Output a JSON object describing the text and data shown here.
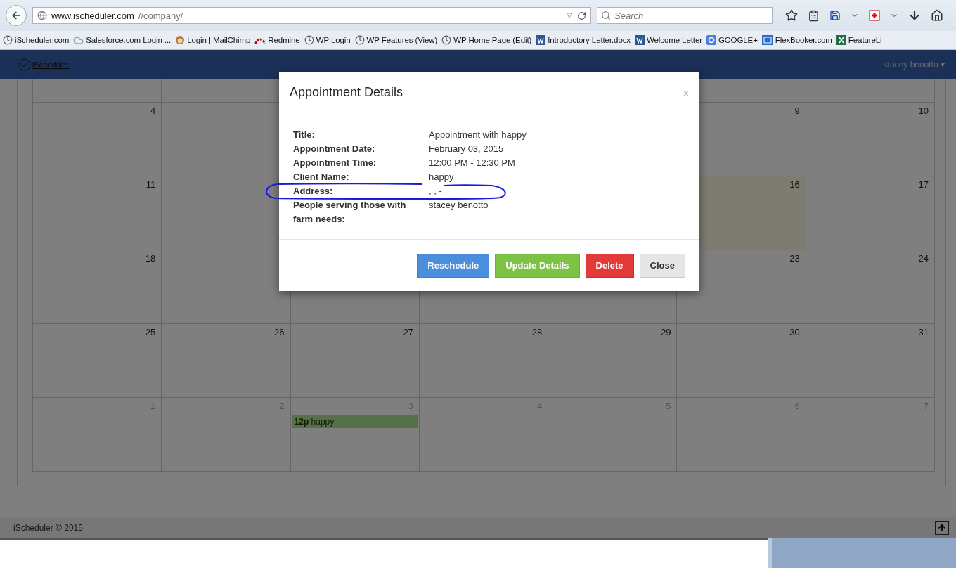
{
  "browser": {
    "url_host": "www.ischeduler.com",
    "url_path": "//company/",
    "search_placeholder": "Search",
    "bookmarks": [
      {
        "kind": "clock",
        "label": "iScheduler.com"
      },
      {
        "kind": "cloud",
        "label": "Salesforce.com Login ..."
      },
      {
        "kind": "monkey",
        "label": "Login | MailChimp"
      },
      {
        "kind": "arc",
        "label": "Redmine"
      },
      {
        "kind": "clock",
        "label": "WP Login"
      },
      {
        "kind": "clock",
        "label": "WP Features (View)"
      },
      {
        "kind": "clock",
        "label": "WP Home Page (Edit)"
      },
      {
        "kind": "word",
        "label": "Introductory Letter.docx"
      },
      {
        "kind": "word",
        "label": "Welcome Letter"
      },
      {
        "kind": "google",
        "label": "GOOGLE+"
      },
      {
        "kind": "fb",
        "label": "FlexBooker.com"
      },
      {
        "kind": "excel",
        "label": "FeatureLi"
      }
    ]
  },
  "app": {
    "logo": "iScheduler",
    "user": "stacey benotto ▾"
  },
  "calendar": {
    "weeks": [
      {
        "start": [
          {
            "day": "4",
            "highlighted": false,
            "other_month": false
          }
        ],
        "end": [
          {
            "day": "9",
            "highlighted": false,
            "other_month": false
          },
          {
            "day": "10",
            "highlighted": false,
            "other_month": false
          }
        ]
      },
      {
        "start": [
          {
            "day": "11",
            "highlighted": false,
            "other_month": false
          }
        ],
        "end": [
          {
            "day": "16",
            "highlighted": true,
            "other_month": false
          },
          {
            "day": "17",
            "highlighted": false,
            "other_month": false
          }
        ]
      },
      {
        "start": [
          {
            "day": "18",
            "highlighted": false,
            "other_month": false
          }
        ],
        "end": [
          {
            "day": "23",
            "highlighted": false,
            "other_month": false
          },
          {
            "day": "24",
            "highlighted": false,
            "other_month": false
          }
        ]
      },
      {
        "start": [
          {
            "day": "25",
            "highlighted": false,
            "other_month": false
          },
          {
            "day": "26",
            "highlighted": false,
            "other_month": false
          },
          {
            "day": "27",
            "highlighted": false,
            "other_month": false
          },
          {
            "day": "28",
            "highlighted": false,
            "other_month": false
          },
          {
            "day": "29",
            "highlighted": false,
            "other_month": false
          },
          {
            "day": "30",
            "highlighted": false,
            "other_month": false
          },
          {
            "day": "31",
            "highlighted": false,
            "other_month": false
          }
        ]
      },
      {
        "start": [
          {
            "day": "1",
            "highlighted": false,
            "other_month": true
          },
          {
            "day": "2",
            "highlighted": false,
            "other_month": true
          },
          {
            "day": "3",
            "highlighted": false,
            "other_month": true,
            "events": [
              {
                "text": "**12p** happy"
              }
            ]
          },
          {
            "day": "4",
            "highlighted": false,
            "other_month": true
          },
          {
            "day": "5",
            "highlighted": false,
            "other_month": true
          },
          {
            "day": "6",
            "highlighted": false,
            "other_month": true
          },
          {
            "day": "7",
            "highlighted": false,
            "other_month": true
          }
        ]
      }
    ]
  },
  "modal": {
    "title": "Appointment Details",
    "close": "x",
    "details": [
      {
        "label": "Title:",
        "value": "Appointment with happy"
      },
      {
        "label": "Appointment Date:",
        "value": "February 03, 2015"
      },
      {
        "label": "Appointment Time:",
        "value": "12:00 PM - 12:30 PM"
      },
      {
        "label": "Client Name:",
        "value": "happy"
      },
      {
        "label": "Address:",
        "value": ", , -"
      },
      {
        "label": "People serving those with farm needs:",
        "value": "stacey benotto"
      }
    ],
    "buttons": [
      {
        "kind": "primary",
        "label": "Reschedule"
      },
      {
        "kind": "success",
        "label": "Update Details"
      },
      {
        "kind": "danger",
        "label": "Delete"
      },
      {
        "kind": "default",
        "label": "Close"
      }
    ]
  },
  "footer": {
    "copyright": "iScheduler © 2015"
  }
}
